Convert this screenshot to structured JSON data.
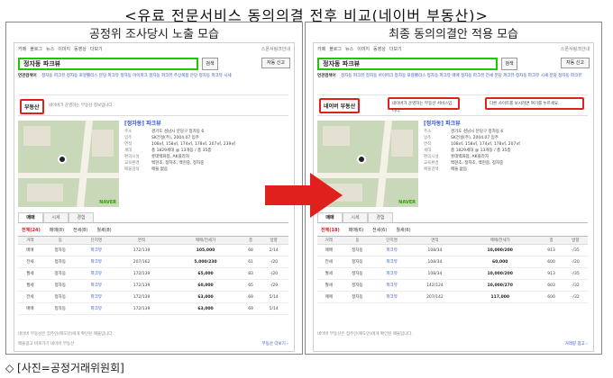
{
  "title": "<유료 전문서비스 동의의결 전후 비교(네이버 부동산)>",
  "caption": "◇ [사진=공정거래위원회]",
  "accent_color": "#e0201c",
  "arrow_color": "#e0201c",
  "panels": {
    "left": {
      "subtitle": "공정위 조사당시 노출 모습",
      "nav": [
        "카페",
        "블로그",
        "뉴스",
        "이미지",
        "동영상",
        "더보기"
      ],
      "toplinks": "스폰서링크안내",
      "search_value": "정자동 파크뷰",
      "search_button": "검색",
      "side_button": "자동 신고",
      "related_label": "연관검색어",
      "related": "정자동 파크뷰  정자동 로얄팰리스  분당 파크뷰  정자동 아이파크  정자동 파크뷰 주상복합  분당 정자동 파크뷰 시세",
      "section_label": "부동산",
      "section_desc": "네이버가 운영하는 부동산 정보입니다.",
      "listing": {
        "name": "[정자동] 파크뷰",
        "lines": [
          {
            "label": "주소",
            "value": "경기도 성남시 분당구 정자동 6"
          },
          {
            "label": "입주",
            "value": "SK건설(주), 2004.07 입주"
          },
          {
            "label": "면적",
            "value": "108㎡, 158㎡, 174㎡, 178㎡, 207㎡, 239㎡"
          },
          {
            "label": "세대",
            "value": "총 1829세대 @ 13개동 / 총 35층"
          },
          {
            "label": "편의시설",
            "value": "롯데백화점, AK플라자"
          },
          {
            "label": "교육환경",
            "value": "백현초, 정자초, 백현중, 정자중"
          },
          {
            "label": "매물검색",
            "value": "매물 없음"
          }
        ]
      },
      "map_logo": "NAVER",
      "tabs": [
        "매매",
        "시세",
        "경험"
      ],
      "radios": [
        "전체(24)",
        "매매(8)",
        "전세(8)",
        "월세(8)"
      ],
      "table_headers": [
        "거래",
        "동",
        "단지명",
        "면적",
        "매매/전세가",
        "층",
        "방향"
      ],
      "rows": [
        [
          "매매",
          "정자동",
          "파크뷰",
          "172/139",
          "105,000",
          "68",
          "2/14"
        ],
        [
          "전세",
          "정자동",
          "파크뷰",
          "207/162",
          "5,000/230",
          "61",
          "-/20"
        ],
        [
          "월세",
          "정자동",
          "파크뷰",
          "172/139",
          "65,000",
          "83",
          "-/20"
        ],
        [
          "월세",
          "정자동",
          "파크뷰",
          "172/139",
          "60,000",
          "65",
          "-/29"
        ],
        [
          "전세",
          "정자동",
          "파크뷰",
          "172/139",
          "63,000",
          "69",
          "5/14"
        ],
        [
          "매매",
          "정자동",
          "파크뷰",
          "172/139",
          "63,000",
          "69",
          "5/14"
        ]
      ],
      "footnote": "네이버 부동산은 집주인(매도인)에게 확인된 매물입니다.",
      "footnote2": "매물광고 바로가기  네이버 부동산",
      "more_link": "부동산 더보기 ›"
    },
    "right": {
      "subtitle": "최종 동의의결안 적용 모습",
      "nav": [
        "카페",
        "블로그",
        "뉴스",
        "이미지",
        "동영상",
        "더보기"
      ],
      "toplinks": "스폰서링크안내",
      "search_value": "정자동 파크뷰",
      "search_button": "검색",
      "side_button": "자동 신고",
      "related_label": "연관검색어",
      "related": "정자동 파크뷰  정자동 아이파크  정자동 로얄팰리스  정자동 파크뷰 매매  정자동 파크뷰 전세  분당 파크뷰  정자동 파크뷰 시세  분당 정자동 파크뷰",
      "section_label": "네이버 부동산",
      "info_text": "네이버가 운영하는 부동산 서비스입니다.",
      "info_text2": "다른 사이트를 보시려면 여기를 누르세요.",
      "listing": {
        "name": "[정자동] 파크뷰",
        "lines": [
          {
            "label": "주소",
            "value": "경기도 성남시 분당구 정자동 6"
          },
          {
            "label": "입주",
            "value": "SK건설(주), 2004.07 입주"
          },
          {
            "label": "면적",
            "value": "108㎡, 158㎡, 174㎡, 178㎡, 207㎡"
          },
          {
            "label": "세대",
            "value": "총 1829세대 @ 13개동 / 총 35층"
          },
          {
            "label": "편의시설",
            "value": "롯데백화점, AK플라자"
          },
          {
            "label": "교육환경",
            "value": "백현초, 정자초, 백현중, 정자중"
          },
          {
            "label": "매물검색",
            "value": "매물 없음"
          }
        ]
      },
      "map_logo": "NAVER",
      "tabs": [
        "매매",
        "시세",
        "경험"
      ],
      "radios": [
        "전체(18)",
        "매매(6)",
        "전세(6)",
        "월세(6)"
      ],
      "table_headers": [
        "거래",
        "동",
        "단지명",
        "면적",
        "매매/전세가",
        "층",
        "방향"
      ],
      "rows": [
        [
          "매매",
          "정자동",
          "파크뷰",
          "108/34",
          "10,000/200",
          "913",
          "-/35"
        ],
        [
          "전세",
          "정자동",
          "파크뷰",
          "108/34",
          "60,000",
          "600",
          "-/20"
        ],
        [
          "월세",
          "정자동",
          "파크뷰",
          "108/34",
          "10,000/200",
          "913",
          "-/35"
        ],
        [
          "월세",
          "정자동",
          "파크뷰",
          "142/124",
          "10,000/270",
          "603",
          "-/32"
        ],
        [
          "매매",
          "정자동",
          "파크뷰",
          "207/142",
          "117,000",
          "600",
          "-/32"
        ]
      ],
      "footnote": "네이버 부동산은 집주인(매도인)에게 확인된 매물입니다.",
      "footnote2": "",
      "more_link": "거래량 참고 ›"
    }
  }
}
